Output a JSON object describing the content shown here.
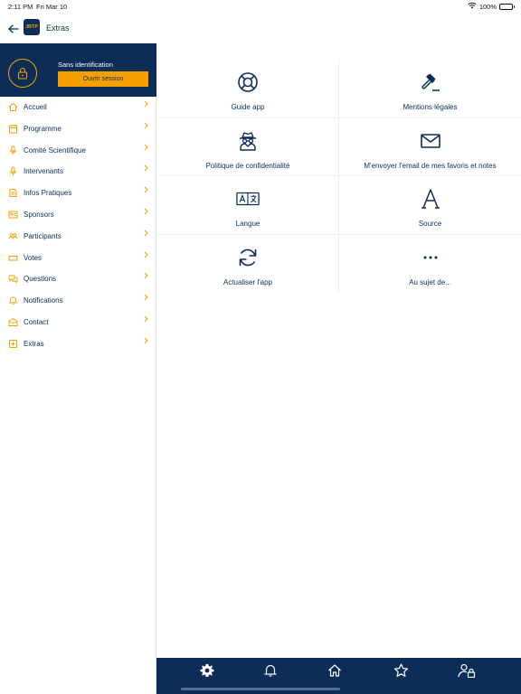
{
  "status_bar": {
    "time": "2:11 PM",
    "date": "Fri Mar 10",
    "battery": "100%",
    "battery_level": 1.0
  },
  "nav_bar": {
    "back_icon": "arrow-left-icon",
    "logo_text": "JBTP",
    "title": "Extras"
  },
  "profile": {
    "avatar_icon": "lock-icon",
    "name": "Sans identification",
    "login_label": "Ouvrir session"
  },
  "menu": {
    "items": [
      {
        "label": "Accueil",
        "icon": "home-icon"
      },
      {
        "label": "Programme",
        "icon": "calendar-icon"
      },
      {
        "label": "Comité Scientifique",
        "icon": "microphone-icon"
      },
      {
        "label": "Intervenants",
        "icon": "microphone-icon"
      },
      {
        "label": "Infos Pratiques",
        "icon": "info-icon"
      },
      {
        "label": "Sponsors",
        "icon": "sponsor-icon"
      },
      {
        "label": "Participants",
        "icon": "people-icon"
      },
      {
        "label": "Votes",
        "icon": "ticket-icon"
      },
      {
        "label": "Questions",
        "icon": "chat-icon"
      },
      {
        "label": "Notifications",
        "icon": "bell-icon"
      },
      {
        "label": "Contact",
        "icon": "envelope-open-icon"
      },
      {
        "label": "Extras",
        "icon": "plus-square-icon"
      }
    ]
  },
  "extras": {
    "items": [
      {
        "label": "Guide app",
        "icon": "lifebuoy-icon"
      },
      {
        "label": "Mentions légales",
        "icon": "gavel-icon"
      },
      {
        "label": "Politique de confidentialité",
        "icon": "spy-icon"
      },
      {
        "label": "M'envoyer l'email de mes favoris et notes",
        "icon": "envelope-icon"
      },
      {
        "label": "Langue",
        "icon": "translate-icon"
      },
      {
        "label": "Source",
        "icon": "font-letter-icon"
      },
      {
        "label": "Actualiser l'app",
        "icon": "refresh-icon"
      },
      {
        "label": "Au sujet de...",
        "icon": "ellipsis-icon"
      }
    ]
  },
  "tab_bar": {
    "tabs": [
      {
        "name": "settings",
        "icon": "gear-icon",
        "active": true
      },
      {
        "name": "notifications",
        "icon": "bell-icon",
        "active": false
      },
      {
        "name": "home",
        "icon": "home-icon",
        "active": false
      },
      {
        "name": "favorites",
        "icon": "star-icon",
        "active": false
      },
      {
        "name": "account",
        "icon": "user-lock-icon",
        "active": false
      }
    ]
  },
  "colors": {
    "primary": "#0c2d57",
    "accent": "#f5a000",
    "background": "#ffffff"
  }
}
